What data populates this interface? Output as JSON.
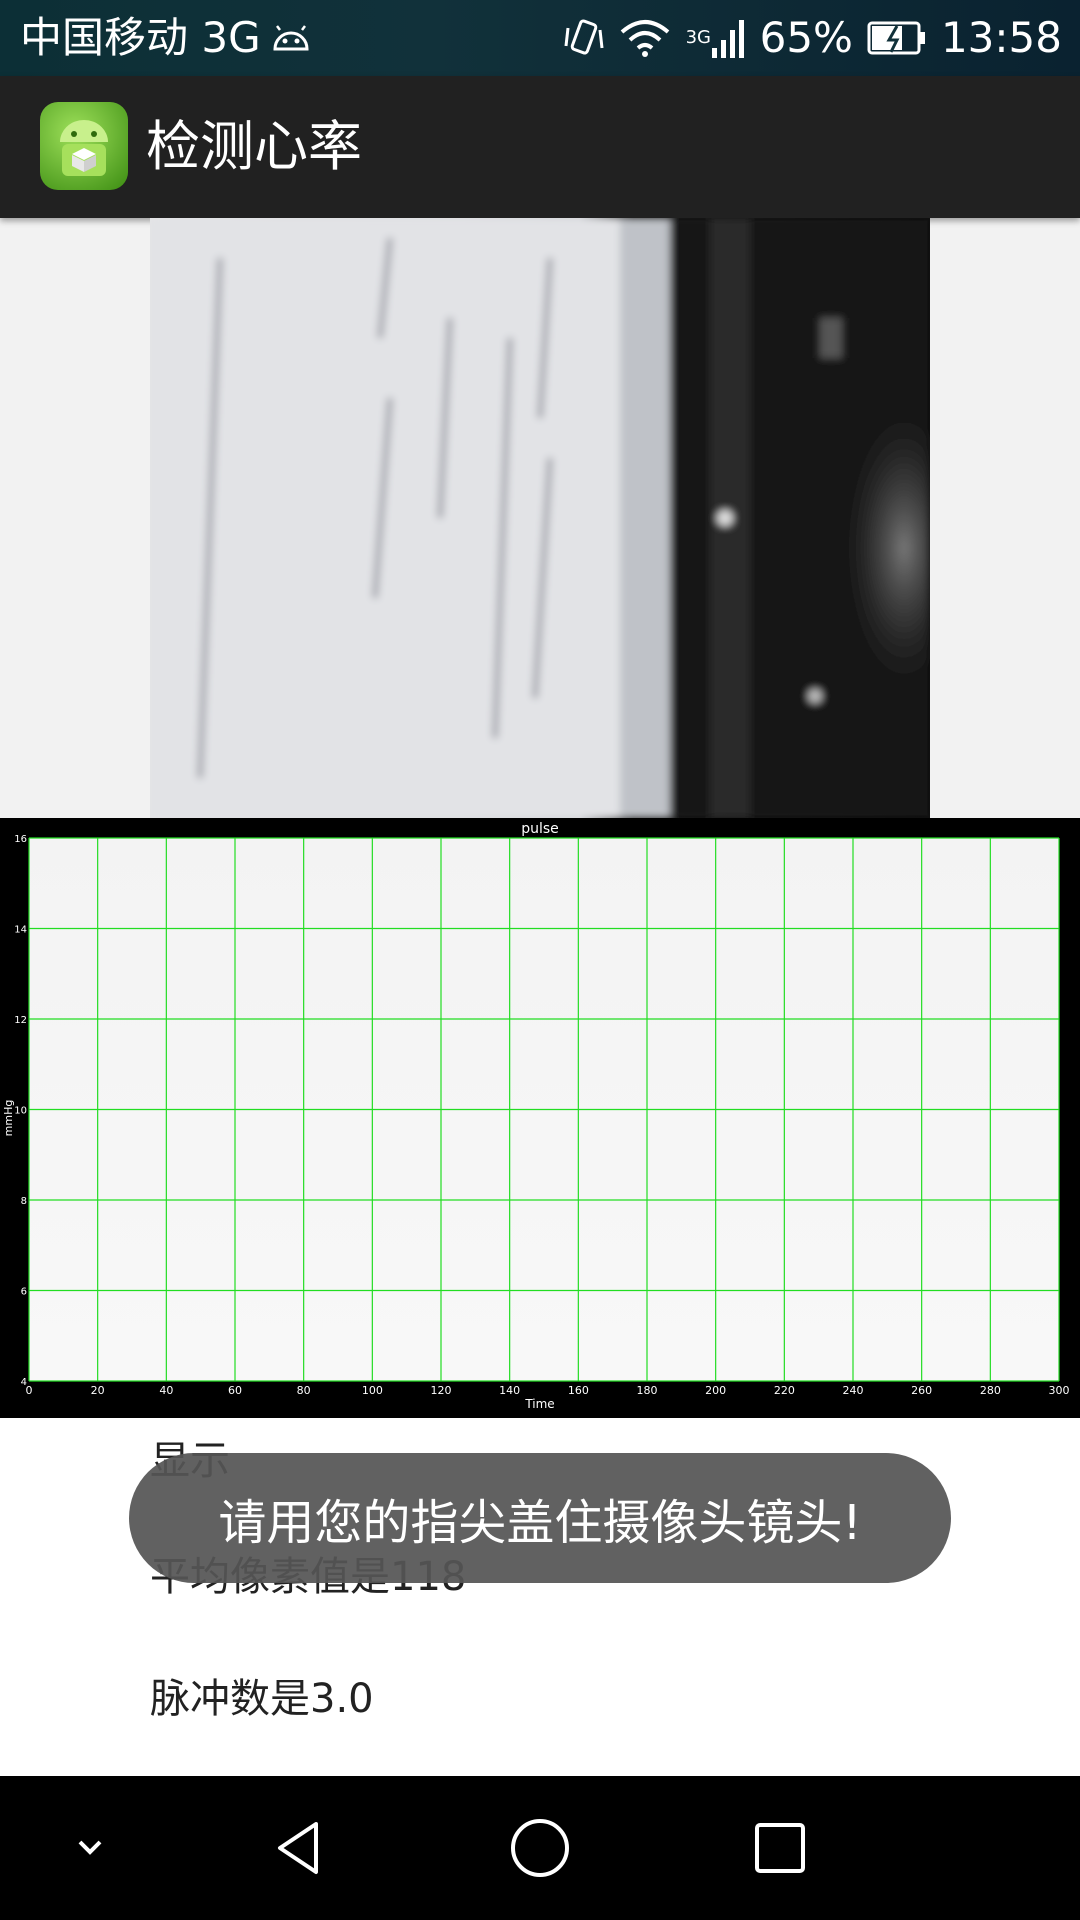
{
  "status_bar": {
    "carrier": "中国移动 3G",
    "network_small": "3G",
    "battery": "65%",
    "time": "13:58"
  },
  "app_bar": {
    "title": "检测心率",
    "icon": "android-app-icon"
  },
  "camera_preview": {
    "icon": "camera-preview-image"
  },
  "chart_data": {
    "type": "line",
    "title": "pulse",
    "xlabel": "Time",
    "ylabel": "mmHg",
    "xlim": [
      0,
      300
    ],
    "ylim": [
      4,
      16
    ],
    "x_ticks": [
      "0",
      "20",
      "40",
      "60",
      "80",
      "100",
      "120",
      "140",
      "160",
      "180",
      "200",
      "220",
      "240",
      "260",
      "280",
      "300"
    ],
    "y_ticks": [
      "4",
      "6",
      "8",
      "10",
      "12",
      "14",
      "16"
    ],
    "grid": true,
    "series": [],
    "colors": {
      "grid": "#22dd22",
      "plot_background": "#f4f4f4",
      "background": "#000000"
    }
  },
  "content": {
    "display_label": "显示",
    "avg_pixel_text": "平均像素值是118",
    "pulse_count_text": "脉冲数是3.0"
  },
  "toast": {
    "message": "请用您的指尖盖住摄像头镜头!"
  },
  "nav_bar": {
    "icons": [
      "chevron-down-icon",
      "back-icon",
      "home-icon",
      "recents-icon"
    ]
  }
}
